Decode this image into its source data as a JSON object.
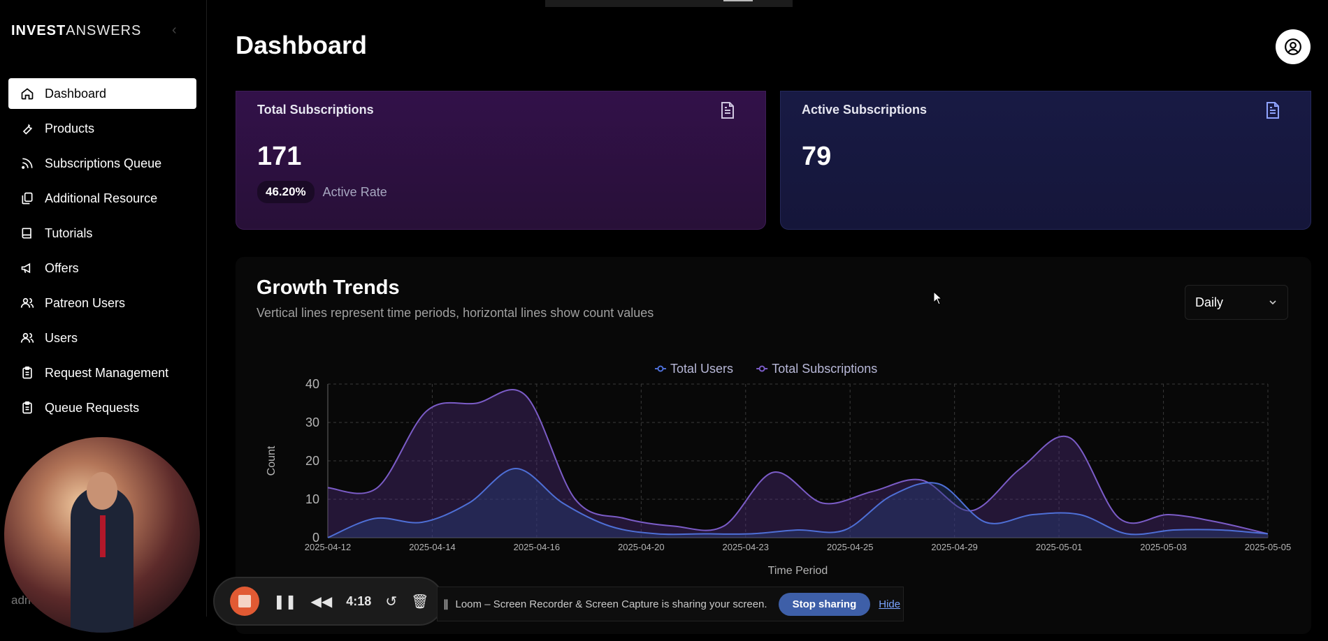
{
  "brand": {
    "bold": "INVEST",
    "light": "ANSWERS"
  },
  "sidebar": {
    "items": [
      {
        "label": "Dashboard",
        "icon": "home-icon",
        "active": true
      },
      {
        "label": "Products",
        "icon": "wrench-icon"
      },
      {
        "label": "Subscriptions Queue",
        "icon": "rss-icon"
      },
      {
        "label": "Additional Resource",
        "icon": "copy-icon"
      },
      {
        "label": "Tutorials",
        "icon": "book-icon"
      },
      {
        "label": "Offers",
        "icon": "megaphone-icon"
      },
      {
        "label": "Patreon Users",
        "icon": "users-icon"
      },
      {
        "label": "Users",
        "icon": "users-icon"
      },
      {
        "label": "Request Management",
        "icon": "clipboard-icon"
      },
      {
        "label": "Queue Requests",
        "icon": "clipboard-icon"
      }
    ],
    "footer_user": "admin"
  },
  "header": {
    "title": "Dashboard"
  },
  "cards": {
    "total": {
      "title": "Total Subscriptions",
      "value": "171",
      "rate": "46.20%",
      "rate_label": "Active Rate"
    },
    "active": {
      "title": "Active Subscriptions",
      "value": "79"
    }
  },
  "growth": {
    "title": "Growth Trends",
    "subtitle": "Vertical lines represent time periods, horizontal lines show count values",
    "period_select": "Daily"
  },
  "chart_data": {
    "type": "area",
    "xlabel": "Time Period",
    "ylabel": "Count",
    "ylim": [
      0,
      40
    ],
    "yticks": [
      0,
      10,
      20,
      30,
      40
    ],
    "grid": true,
    "legend": "top-center",
    "categories": [
      "2025-04-12",
      "2025-04-14",
      "2025-04-16",
      "2025-04-20",
      "2025-04-23",
      "2025-04-25",
      "2025-04-29",
      "2025-05-01",
      "2025-05-03",
      "2025-05-05"
    ],
    "series": [
      {
        "name": "Total Users",
        "color": "#4e6fd6",
        "values": [
          0,
          5,
          4,
          9,
          18,
          9,
          3,
          1,
          1,
          1,
          2,
          2,
          11,
          14,
          4,
          6,
          6,
          1,
          2,
          2,
          1
        ]
      },
      {
        "name": "Total Subscriptions",
        "color": "#7b5cc7",
        "values": [
          13,
          13,
          33,
          35,
          37,
          10,
          5,
          3,
          3,
          17,
          9,
          12,
          15,
          7,
          18,
          26,
          5,
          6,
          4,
          1
        ]
      }
    ]
  },
  "loom": {
    "time": "4:18",
    "message": "Loom – Screen Recorder & Screen Capture is sharing your screen.",
    "stop_label": "Stop sharing",
    "hide_label": "Hide"
  }
}
